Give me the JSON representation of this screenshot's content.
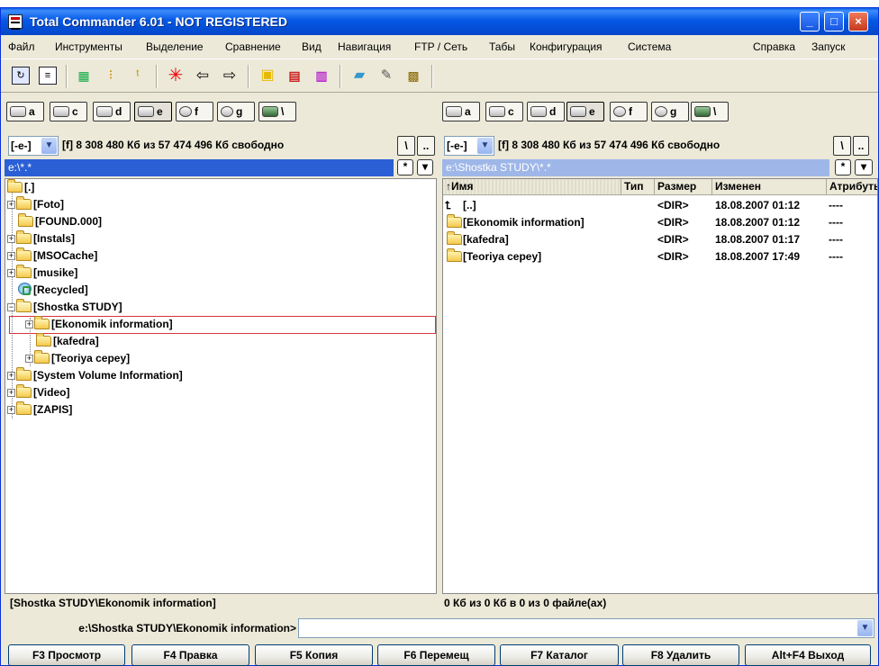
{
  "window": {
    "title": "Total Commander 6.01 - NOT REGISTERED",
    "min_label": "_",
    "max_label": "□",
    "close_label": "×"
  },
  "menu": [
    "Файл",
    "Инструменты",
    "Выделение",
    "Сравнение",
    "Вид",
    "Навигация",
    "FTP / Сеть",
    "Табы",
    "Конфигурация",
    "Система",
    "Справка",
    "Запуск"
  ],
  "toolbar_icons": [
    "refresh-icon",
    "brief-view-icon",
    "full-view-icon",
    "tree-view-icon",
    "thumbnail-icon",
    "cancel-icon",
    "back-icon",
    "forward-icon",
    "pack-icon",
    "ftp-connect-icon",
    "ftp-new-connection-icon",
    "notepad-icon",
    "edit-icon",
    "multirename-icon"
  ],
  "left": {
    "drives": [
      "a",
      "c",
      "d",
      "e",
      "f",
      "g",
      "\\"
    ],
    "drive_combo": "[-e-]",
    "free_info": "[f]  8 308 480 Кб из 57 474 496 Кб свободно",
    "root_btn": "\\",
    "up_btn": "..",
    "path": "e:\\*.*",
    "tree": [
      {
        "label": "[.]",
        "level": 0,
        "expander": ""
      },
      {
        "label": "[Foto]",
        "level": 1,
        "expander": "+"
      },
      {
        "label": "[FOUND.000]",
        "level": 1,
        "expander": ""
      },
      {
        "label": "[Instals]",
        "level": 1,
        "expander": "+"
      },
      {
        "label": "[MSOCache]",
        "level": 1,
        "expander": "+"
      },
      {
        "label": "[musike]",
        "level": 1,
        "expander": "+"
      },
      {
        "label": "[Recycled]",
        "level": 1,
        "expander": ""
      },
      {
        "label": "[Shostka STUDY]",
        "level": 1,
        "expander": "-"
      },
      {
        "label": "[Ekonomik information]",
        "level": 2,
        "expander": "+"
      },
      {
        "label": "[kafedra]",
        "level": 2,
        "expander": ""
      },
      {
        "label": "[Teoriya cepey]",
        "level": 2,
        "expander": "+"
      },
      {
        "label": "[System Volume Information]",
        "level": 1,
        "expander": "+"
      },
      {
        "label": "[Video]",
        "level": 1,
        "expander": "+"
      },
      {
        "label": "[ZAPIS]",
        "level": 1,
        "expander": "+"
      }
    ],
    "status": "[Shostka STUDY\\Ekonomik information]"
  },
  "right": {
    "drives": [
      "a",
      "c",
      "d",
      "e",
      "f",
      "g",
      "\\"
    ],
    "drive_combo": "[-e-]",
    "free_info": "[f]  8 308 480 Кб из 57 474 496 Кб свободно",
    "root_btn": "\\",
    "up_btn": "..",
    "path": "e:\\Shostka STUDY\\*.*",
    "columns": [
      "↑Имя",
      "Тип",
      "Размер",
      "Изменен",
      "Атрибуты"
    ],
    "files": [
      {
        "name": "[..]",
        "type": "",
        "size": "<DIR>",
        "date": "18.08.2007 01:12",
        "attr": "----"
      },
      {
        "name": "[Ekonomik information]",
        "type": "",
        "size": "<DIR>",
        "date": "18.08.2007 01:12",
        "attr": "----"
      },
      {
        "name": "[kafedra]",
        "type": "",
        "size": "<DIR>",
        "date": "18.08.2007 01:17",
        "attr": "----"
      },
      {
        "name": "[Teoriya cepey]",
        "type": "",
        "size": "<DIR>",
        "date": "18.08.2007 17:49",
        "attr": "----"
      }
    ],
    "status": "0 Кб из 0 Кб в 0 из 0 файле(ах)"
  },
  "command_line": {
    "prompt": "e:\\Shostka STUDY\\Ekonomik information>",
    "value": ""
  },
  "fkeys": [
    "F3 Просмотр",
    "F4 Правка",
    "F5 Копия",
    "F6 Перемещ",
    "F7 Каталог",
    "F8 Удалить",
    "Alt+F4 Выход"
  ],
  "colors": {
    "title_bar": "#0558e6",
    "active_path": "#2b5fd6",
    "inactive_path": "#9fb7e8",
    "selection_border": "#d4343c"
  }
}
